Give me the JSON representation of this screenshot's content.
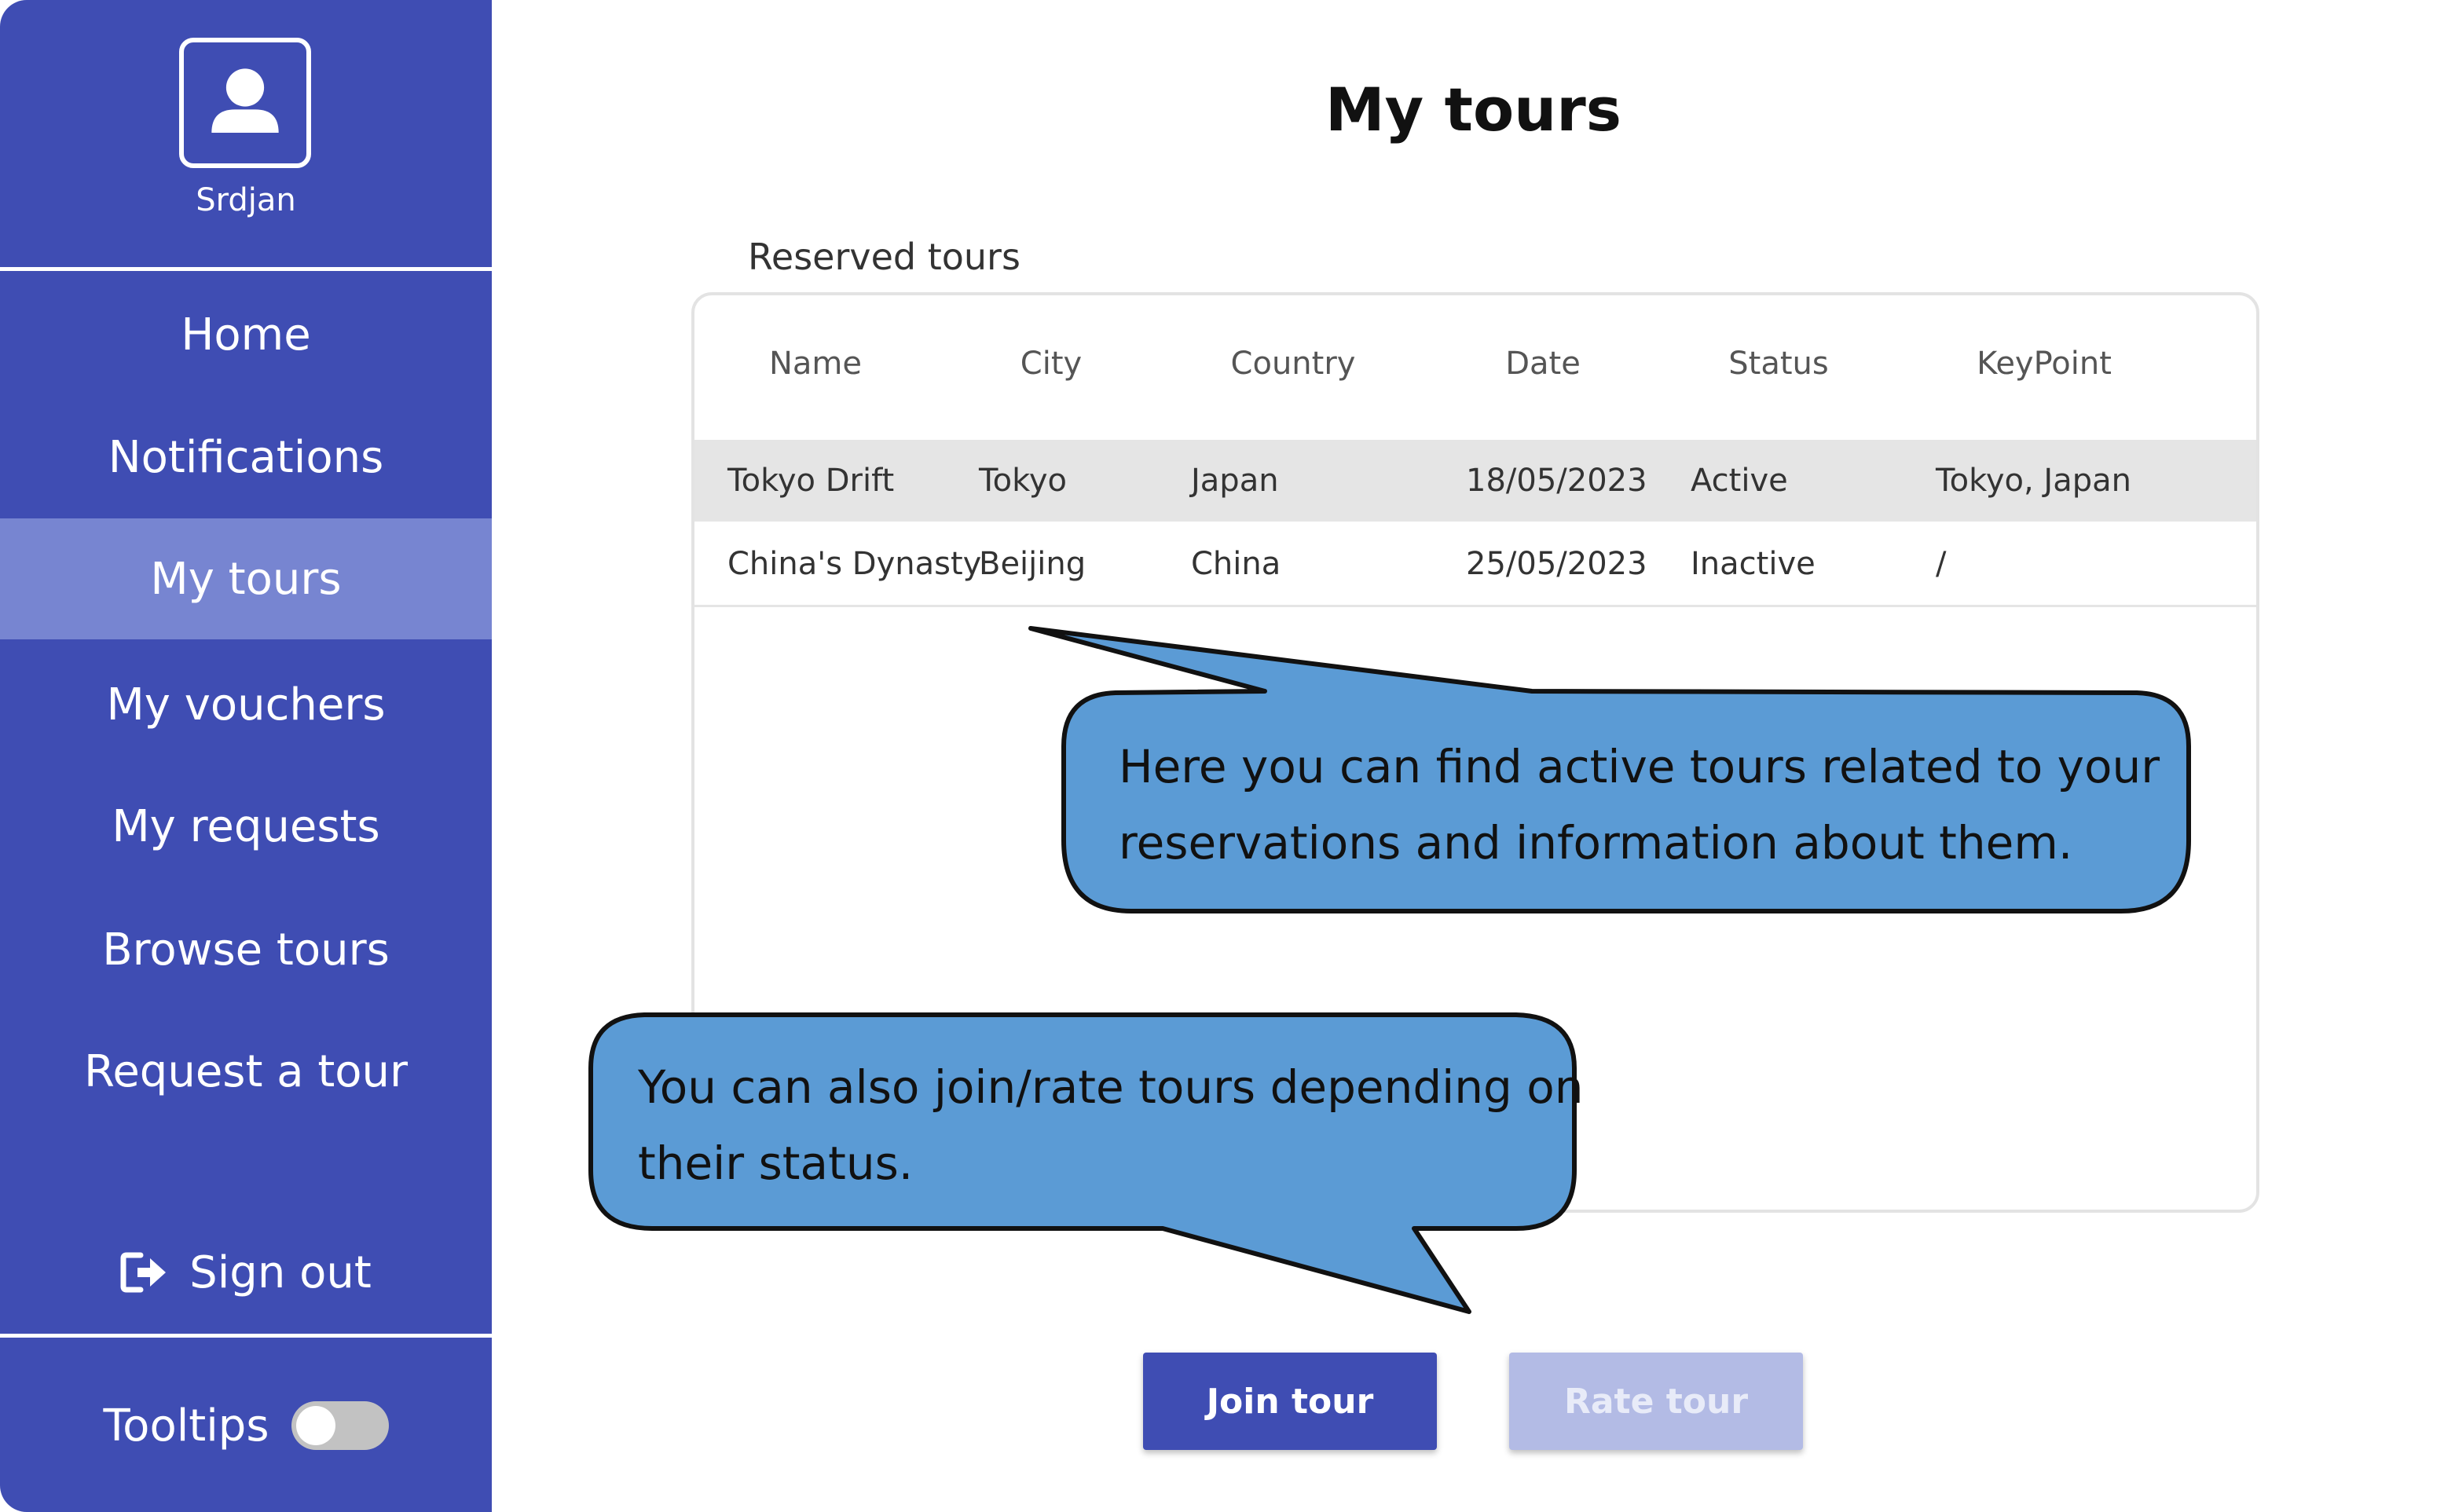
{
  "sidebar": {
    "username": "Srdjan",
    "nav": [
      {
        "label": "Home"
      },
      {
        "label": "Notifications"
      },
      {
        "label": "My tours",
        "active": true
      },
      {
        "label": "My vouchers"
      },
      {
        "label": "My requests"
      },
      {
        "label": "Browse tours"
      },
      {
        "label": "Request a tour"
      }
    ],
    "signout_label": "Sign out",
    "tooltips_label": "Tooltips",
    "tooltips_on": false
  },
  "main": {
    "title": "My tours",
    "section_label": "Reserved tours",
    "table": {
      "columns": [
        "Name",
        "City",
        "Country",
        "Date",
        "Status",
        "KeyPoint"
      ],
      "rows": [
        [
          "Tokyo Drift",
          "Tokyo",
          "Japan",
          "18/05/2023",
          "Active",
          "Tokyo, Japan"
        ],
        [
          "China's Dynasty",
          "Beijing",
          "China",
          "25/05/2023",
          "Inactive",
          "/"
        ]
      ]
    },
    "buttons": {
      "join_label": "Join tour",
      "rate_label": "Rate tour"
    }
  },
  "callouts": {
    "first_line1": "Here you can find active tours related to your",
    "first_line2": "reservations and information about them.",
    "second_line1": "You can also join/rate tours depending on",
    "second_line2": "their status."
  },
  "colors": {
    "sidebar_bg": "#3f4db3",
    "sidebar_active": "#7785d1",
    "callout_fill": "#5b9bd5",
    "primary_button": "#3f4db3",
    "disabled_button": "#b3bbe5"
  }
}
